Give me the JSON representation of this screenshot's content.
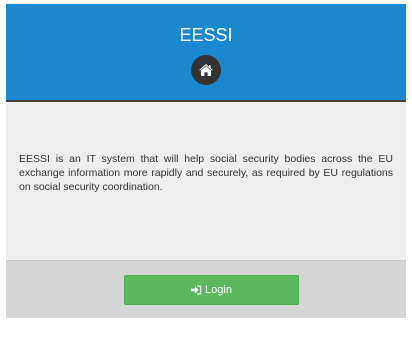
{
  "header": {
    "title": "EESSI",
    "home_icon": "home-icon"
  },
  "body": {
    "description": "EESSI is an IT system that will help social security bodies across the EU exchange information more rapidly and securely, as required by EU regulations on social security coordination."
  },
  "footer": {
    "login_label": "Login",
    "login_icon": "sign-in-icon"
  },
  "colors": {
    "header_bg": "#1a87cf",
    "body_bg": "#eeeeee",
    "footer_bg": "#d5d5d5",
    "login_button": "#5cb85c",
    "home_circle": "#333333"
  }
}
